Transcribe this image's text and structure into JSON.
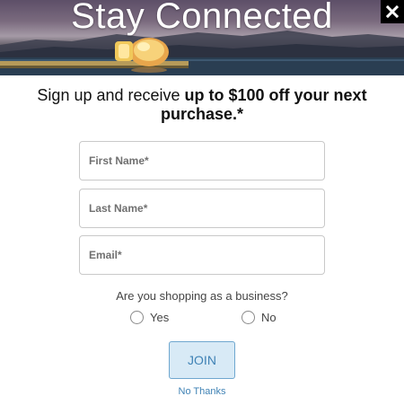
{
  "hero": {
    "title": "Stay Connected"
  },
  "close": {
    "icon": "close-icon"
  },
  "headline": {
    "lead": "Sign up and receive ",
    "bold": "up to $100 off your next purchase.*"
  },
  "form": {
    "first_name_placeholder": "First Name*",
    "last_name_placeholder": "Last Name*",
    "email_placeholder": "Email*"
  },
  "business_question": {
    "label": "Are you shopping as a business?",
    "options": [
      {
        "label": "Yes"
      },
      {
        "label": "No"
      }
    ]
  },
  "actions": {
    "join_label": "JOIN",
    "no_thanks_label": "No Thanks"
  },
  "colors": {
    "accent": "#3f82b5",
    "button_bg": "#d8eaf6",
    "button_border": "#6fa7cf"
  }
}
